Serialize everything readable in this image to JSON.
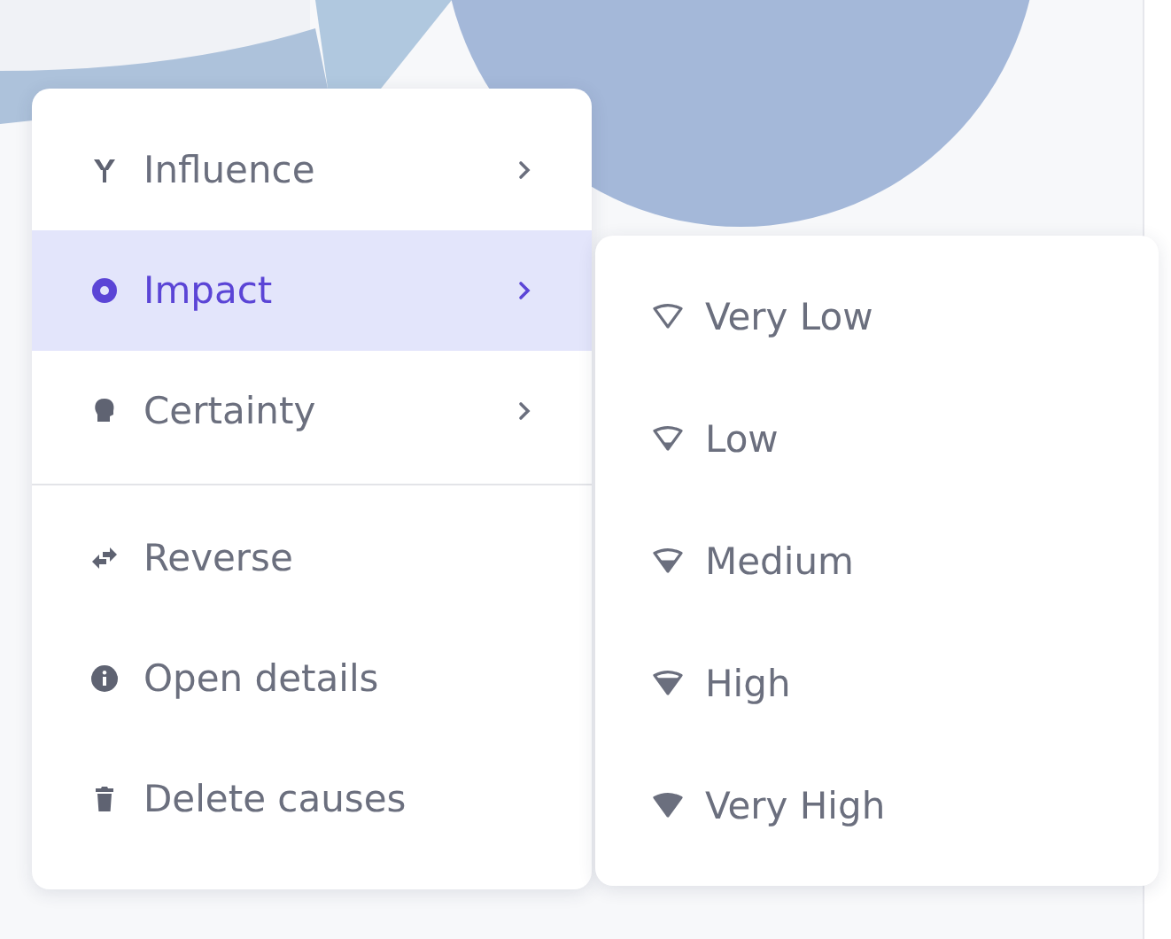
{
  "context_menu": {
    "groups": [
      [
        {
          "label": "Influence",
          "submenu": true,
          "selected": false
        },
        {
          "label": "Impact",
          "submenu": true,
          "selected": true
        },
        {
          "label": "Certainty",
          "submenu": true,
          "selected": false
        }
      ],
      [
        {
          "label": "Reverse",
          "submenu": false,
          "selected": false
        },
        {
          "label": "Open details",
          "submenu": false,
          "selected": false
        },
        {
          "label": "Delete causes",
          "submenu": false,
          "selected": false
        }
      ]
    ]
  },
  "impact_submenu": {
    "items": [
      {
        "label": "Very Low"
      },
      {
        "label": "Low"
      },
      {
        "label": "Medium"
      },
      {
        "label": "High"
      },
      {
        "label": "Very High"
      }
    ]
  }
}
